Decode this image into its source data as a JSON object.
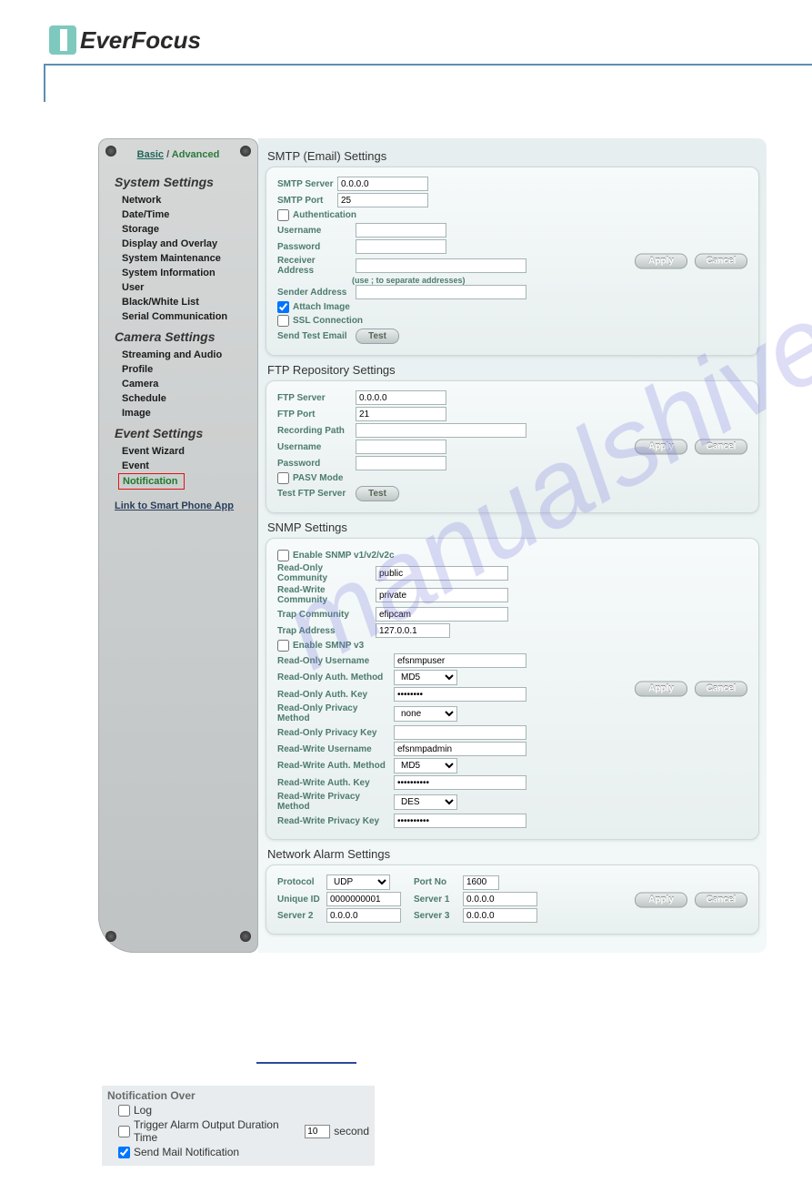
{
  "brand": "EverFocus",
  "watermark": "manualshive.com",
  "tabs": {
    "basic": "Basic",
    "sep": "/",
    "advanced": "Advanced"
  },
  "sidebar": {
    "head1": "System Settings",
    "sys": [
      "Network",
      "Date/Time",
      "Storage",
      "Display and Overlay",
      "System Maintenance",
      "System Information",
      "User",
      "Black/White List",
      "Serial Communication"
    ],
    "head2": "Camera Settings",
    "cam": [
      "Streaming and Audio",
      "Profile",
      "Camera",
      "Schedule",
      "Image"
    ],
    "head3": "Event Settings",
    "evt": [
      "Event Wizard",
      "Event",
      "Notification"
    ],
    "link": "Link to Smart Phone App"
  },
  "buttons": {
    "apply": "Apply",
    "cancel": "Cancel",
    "test": "Test"
  },
  "smtp": {
    "title": "SMTP (Email) Settings",
    "server_lbl": "SMTP Server",
    "server": "0.0.0.0",
    "port_lbl": "SMTP Port",
    "port": "25",
    "auth_lbl": "Authentication",
    "user_lbl": "Username",
    "user": "",
    "pass_lbl": "Password",
    "pass": "",
    "recv_lbl": "Receiver Address",
    "recv": "",
    "hint": "(use ; to separate addresses)",
    "send_lbl": "Sender Address",
    "send": "",
    "attach_lbl": "Attach Image",
    "ssl_lbl": "SSL Connection",
    "testmail_lbl": "Send Test Email"
  },
  "ftp": {
    "title": "FTP Repository Settings",
    "server_lbl": "FTP Server",
    "server": "0.0.0.0",
    "port_lbl": "FTP Port",
    "port": "21",
    "path_lbl": "Recording Path",
    "path": "",
    "user_lbl": "Username",
    "user": "",
    "pass_lbl": "Password",
    "pass": "",
    "pasv_lbl": "PASV Mode",
    "testftp_lbl": "Test FTP Server"
  },
  "snmp": {
    "title": "SNMP Settings",
    "en12_lbl": "Enable SNMP v1/v2/v2c",
    "ro_com_lbl": "Read-Only Community",
    "ro_com": "public",
    "rw_com_lbl": "Read-Write Community",
    "rw_com": "private",
    "trap_com_lbl": "Trap Community",
    "trap_com": "efipcam",
    "trap_addr_lbl": "Trap Address",
    "trap_addr": "127.0.0.1",
    "en3_lbl": "Enable SMNP v3",
    "ro_user_lbl": "Read-Only Username",
    "ro_user": "efsnmpuser",
    "ro_auth_lbl": "Read-Only Auth. Method",
    "ro_auth": "MD5",
    "ro_key_lbl": "Read-Only Auth. Key",
    "ro_key": "••••••••",
    "ro_priv_lbl": "Read-Only Privacy Method",
    "ro_priv": "none",
    "ro_pkey_lbl": "Read-Only Privacy Key",
    "ro_pkey": "",
    "rw_user_lbl": "Read-Write Username",
    "rw_user": "efsnmpadmin",
    "rw_auth_lbl": "Read-Write Auth. Method",
    "rw_auth": "MD5",
    "rw_key_lbl": "Read-Write Auth. Key",
    "rw_key": "••••••••••",
    "rw_priv_lbl": "Read-Write Privacy Method",
    "rw_priv": "DES",
    "rw_pkey_lbl": "Read-Write Privacy Key",
    "rw_pkey": "••••••••••"
  },
  "alarm": {
    "title": "Network Alarm Settings",
    "proto_lbl": "Protocol",
    "proto": "UDP",
    "port_lbl": "Port No",
    "port": "1600",
    "uid_lbl": "Unique ID",
    "uid": "0000000001",
    "s1_lbl": "Server 1",
    "s1": "0.0.0.0",
    "s2_lbl": "Server 2",
    "s2": "0.0.0.0",
    "s3_lbl": "Server 3",
    "s3": "0.0.0.0"
  },
  "notif": {
    "title": "Notification Over",
    "log": "Log",
    "trig": "Trigger Alarm Output Duration Time",
    "trig_val": "10",
    "trig_unit": "second",
    "mail": "Send Mail Notification"
  }
}
